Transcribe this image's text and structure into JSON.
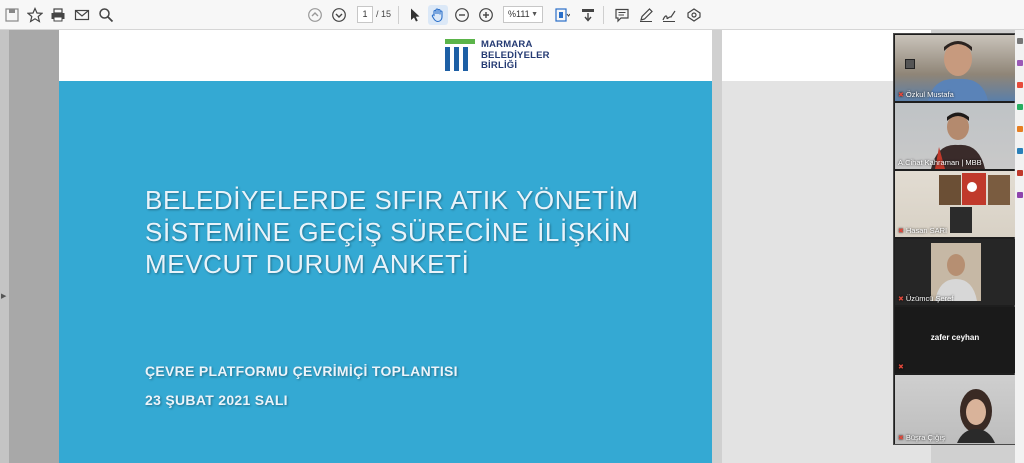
{
  "toolbar": {
    "page_current": "1",
    "page_total": "/ 15",
    "zoom": "%111",
    "buttons": [
      "save-icon",
      "bookmark-star-icon",
      "print-icon",
      "mail-icon",
      "search-icon",
      "page-up-icon",
      "page-down-icon",
      "select-cursor-icon",
      "hand-tool-icon",
      "zoom-out-icon",
      "zoom-in-icon",
      "fit-page-icon",
      "scroll-mode-icon",
      "comment-icon",
      "pen-icon",
      "sign-icon",
      "tools-icon"
    ]
  },
  "slide": {
    "logo_lines": [
      "MARMARA",
      "BELEDİYELER",
      "BİRLİĞİ"
    ],
    "logo_colors": {
      "green": "#5bb44a",
      "blue": "#1d5fa5"
    },
    "title_lines": [
      "BELEDİYELERDE SIFIR ATIK YÖNETİM",
      "SİSTEMİNE GEÇİŞ SÜRECİNE İLİŞKİN",
      "MEVCUT DURUM ANKETİ"
    ],
    "subtitle": "ÇEVRE PLATFORMU ÇEVRİMİÇİ TOPLANTISI",
    "date": "23 ŞUBAT 2021 SALI",
    "background_color": "#34a9d3"
  },
  "participants": [
    {
      "name": "Özkul Mustafa",
      "muted": true
    },
    {
      "name": "A.Cihat Kahraman | MBB",
      "muted": false
    },
    {
      "name": "Hasan SARI",
      "muted": true
    },
    {
      "name": "Üzümcü Şeref",
      "muted": true
    },
    {
      "name": "zafer ceyhan",
      "muted": true
    },
    {
      "name": "Büşra Çığış",
      "muted": true
    }
  ]
}
